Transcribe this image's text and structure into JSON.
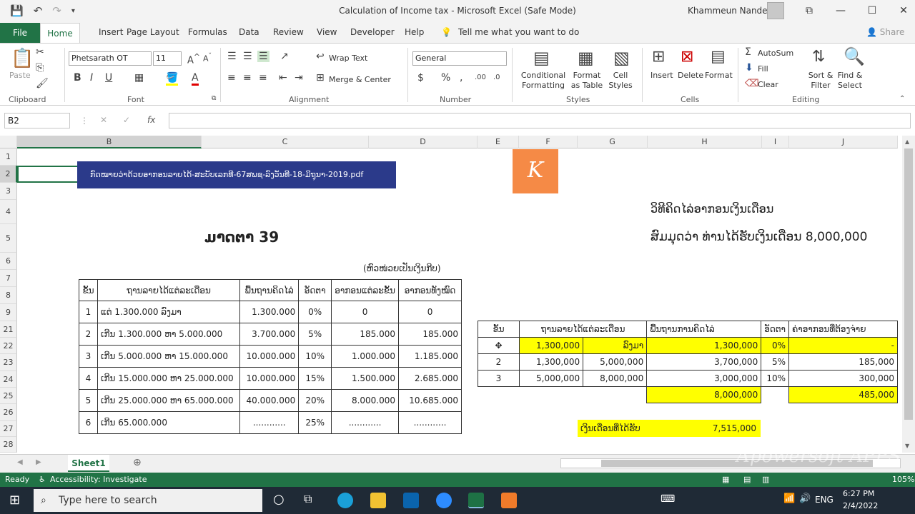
{
  "titlebar": {
    "title": "Calculation of Income tax  -  Microsoft Excel (Safe Mode)",
    "user": "Khammeun Nandee"
  },
  "menu": {
    "file": "File",
    "tabs": [
      "Home",
      "Insert",
      "Page Layout",
      "Formulas",
      "Data",
      "Review",
      "View",
      "Developer",
      "Help"
    ],
    "tell_me": "Tell me what you want to do",
    "share": "Share"
  },
  "ribbon": {
    "clipboard": {
      "label": "Clipboard",
      "paste": "Paste"
    },
    "font": {
      "label": "Font",
      "name": "Phetsarath OT",
      "size": "11"
    },
    "alignment": {
      "label": "Alignment",
      "wrap": "Wrap Text",
      "merge": "Merge & Center"
    },
    "number": {
      "label": "Number",
      "format": "General"
    },
    "styles": {
      "label": "Styles",
      "conditional": "Conditional Formatting",
      "format_table": "Format as Table",
      "cell_styles": "Cell Styles"
    },
    "cells": {
      "label": "Cells",
      "insert": "Insert",
      "delete": "Delete",
      "format": "Format"
    },
    "editing": {
      "label": "Editing",
      "autosum": "AutoSum",
      "fill": "Fill",
      "clear": "Clear",
      "sort": "Sort & Filter",
      "find": "Find & Select"
    }
  },
  "formula_bar": {
    "name_box": "B2",
    "formula": ""
  },
  "columns": [
    "B",
    "C",
    "D",
    "E",
    "F",
    "G",
    "H",
    "I",
    "J"
  ],
  "rows": [
    "1",
    "2",
    "3",
    "4",
    "5",
    "6",
    "7",
    "8",
    "9",
    "21",
    "22",
    "23",
    "24",
    "25",
    "26",
    "27",
    "28"
  ],
  "sheet": {
    "pdf_banner": "ກົດໝາຍວ່າດ້ວຍອາກອນລາຍໄດ້-ສະບັບເລກທີ-67ສພຊ-ລົງວັນທີ-18-ມິຖຸນາ-2019.pdf",
    "logo_letter": "K",
    "article": "ມາດຕາ 39",
    "unit_note": "(ຫົວໜ່ວຍເປັນເງິນກີບ)",
    "heading1": "ວິທີຄິດໄລ່ອາກອນເງິນເດືອນ",
    "heading2": "ສົມມຸດວ່າ ທ່ານໄດ້ຮັບເງິນເດືອນ 8,000,000",
    "law_table": {
      "headers": [
        "ຂັ້ນ",
        "ຖານລາຍໄດ້ແຕ່ລະເດືອນ",
        "ພື້ນຖານຄິດໄລ່",
        "ອັດຕາ",
        "ອາກອນແຕ່ລະຂັ້ນ",
        "ອາກອນທັງໝົດ"
      ],
      "rows": [
        [
          "1",
          "ແຕ່   1.300.000 ລົງມາ",
          "1.300.000",
          "0%",
          "0",
          "0"
        ],
        [
          "2",
          "ເກີນ  1.300.000 ຫາ 5.000.000",
          "3.700.000",
          "5%",
          "185.000",
          "185.000"
        ],
        [
          "3",
          "ເກີນ  5.000.000 ຫາ 15.000.000",
          "10.000.000",
          "10%",
          "1.000.000",
          "1.185.000"
        ],
        [
          "4",
          "ເກີນ 15.000.000 ຫາ 25.000.000",
          "10.000.000",
          "15%",
          "1.500.000",
          "2.685.000"
        ],
        [
          "5",
          "ເກີນ 25.000.000 ຫາ 65.000.000",
          "40.000.000",
          "20%",
          "8.000.000",
          "10.685.000"
        ],
        [
          "6",
          "ເກີນ 65.000.000",
          "............",
          "25%",
          "............",
          "............"
        ]
      ]
    },
    "calc_table": {
      "headers": [
        "ຂັ້ນ",
        "ຖານລາຍໄດ້ແຕ່ລະເດືອນ",
        "ພື້ນຖານການຄິດໄລ່",
        "ອັດຕາ",
        "ຄ່າອາກອນທີ່ຕ້ອງຈ່າຍ"
      ],
      "rows": [
        [
          "",
          "1,300,000",
          "ລົງມາ",
          "1,300,000",
          "0%",
          "-"
        ],
        [
          "2",
          "1,300,000",
          "5,000,000",
          "3,700,000",
          "5%",
          "185,000"
        ],
        [
          "3",
          "5,000,000",
          "8,000,000",
          "3,000,000",
          "10%",
          "300,000"
        ]
      ],
      "total_base": "8,000,000",
      "total_tax": "485,000"
    },
    "net_label": "ເງິນເດືອນທີ່ໄດ້ຮັບ",
    "net_value": "7,515,000"
  },
  "sheet_tab": "Sheet1",
  "status": {
    "ready": "Ready",
    "accessibility": "Accessibility: Investigate",
    "zoom": "105%"
  },
  "taskbar": {
    "search": "Type here to search",
    "lang": "ENG",
    "time": "6:27 PM",
    "date": "2/4/2022"
  },
  "watermark": "Apowersoft APPS"
}
